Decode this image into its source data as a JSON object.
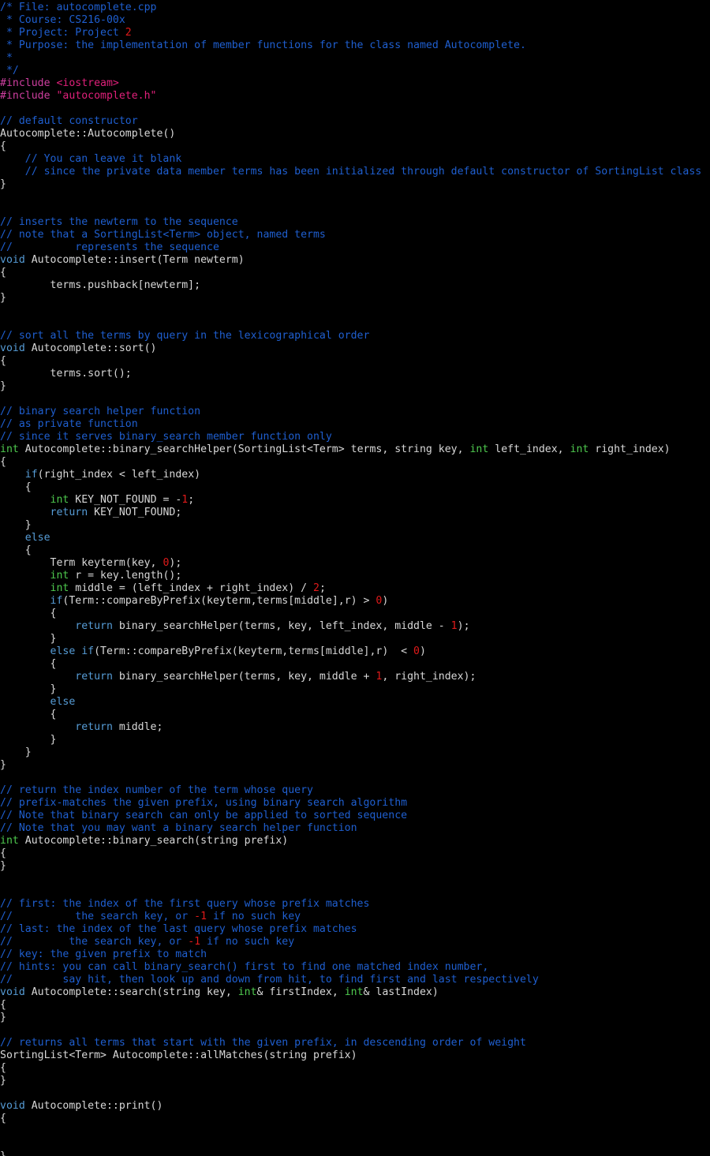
{
  "editor": {
    "file_name": "autocomplete.cpp",
    "colors": {
      "background": "#000000",
      "comment": "#1f5fd0",
      "keyword": "#569cd6",
      "type": "#4ec94e",
      "number": "#e01a1a",
      "string": "#e0207a",
      "directive": "#cf3fa0",
      "plain": "#d8d8d8"
    },
    "lines": [
      [
        [
          "comment",
          "/* File: autocomplete.cpp"
        ]
      ],
      [
        [
          "comment",
          " * Course: CS216-00x"
        ]
      ],
      [
        [
          "comment",
          " * Project: Project "
        ],
        [
          "number",
          "2"
        ]
      ],
      [
        [
          "comment",
          " * Purpose: the implementation of member functions for the class named Autocomplete."
        ]
      ],
      [
        [
          "comment",
          " *"
        ]
      ],
      [
        [
          "comment",
          " */"
        ]
      ],
      [
        [
          "directive",
          "#include "
        ],
        [
          "string",
          "<iostream>"
        ]
      ],
      [
        [
          "directive",
          "#include "
        ],
        [
          "string",
          "\"autocomplete.h\""
        ]
      ],
      [],
      [
        [
          "comment",
          "// default constructor"
        ]
      ],
      [
        [
          "plain",
          "Autocomplete::Autocomplete()"
        ]
      ],
      [
        [
          "plain",
          "{"
        ]
      ],
      [
        [
          "plain",
          "    "
        ],
        [
          "comment",
          "// You can leave it blank"
        ]
      ],
      [
        [
          "plain",
          "    "
        ],
        [
          "comment",
          "// since the private data member terms has been initialized through default constructor of SortingList class"
        ]
      ],
      [
        [
          "plain",
          "}"
        ]
      ],
      [],
      [],
      [
        [
          "comment",
          "// inserts the newterm to the sequence"
        ]
      ],
      [
        [
          "comment",
          "// note that a SortingList<Term> object, named terms"
        ]
      ],
      [
        [
          "comment",
          "//          represents the sequence"
        ]
      ],
      [
        [
          "keyword",
          "void"
        ],
        [
          "plain",
          " Autocomplete::insert(Term newterm)"
        ]
      ],
      [
        [
          "plain",
          "{"
        ]
      ],
      [
        [
          "plain",
          "        terms.pushback[newterm];"
        ]
      ],
      [
        [
          "plain",
          "}"
        ]
      ],
      [],
      [],
      [
        [
          "comment",
          "// sort all the terms by query in the lexicographical order"
        ]
      ],
      [
        [
          "keyword",
          "void"
        ],
        [
          "plain",
          " Autocomplete::sort()"
        ]
      ],
      [
        [
          "plain",
          "{"
        ]
      ],
      [
        [
          "plain",
          "        terms.sort();"
        ]
      ],
      [
        [
          "plain",
          "}"
        ]
      ],
      [],
      [
        [
          "comment",
          "// binary search helper function"
        ]
      ],
      [
        [
          "comment",
          "// as private function"
        ]
      ],
      [
        [
          "comment",
          "// since it serves binary_search member function only"
        ]
      ],
      [
        [
          "type",
          "int"
        ],
        [
          "plain",
          " Autocomplete::binary_searchHelper(SortingList<Term> terms, string key, "
        ],
        [
          "type",
          "int"
        ],
        [
          "plain",
          " left_index, "
        ],
        [
          "type",
          "int"
        ],
        [
          "plain",
          " right_index)"
        ]
      ],
      [
        [
          "plain",
          "{"
        ]
      ],
      [
        [
          "plain",
          "    "
        ],
        [
          "keyword",
          "if"
        ],
        [
          "plain",
          "(right_index < left_index)"
        ]
      ],
      [
        [
          "plain",
          "    {"
        ]
      ],
      [
        [
          "plain",
          "        "
        ],
        [
          "type",
          "int"
        ],
        [
          "plain",
          " KEY_NOT_FOUND = -"
        ],
        [
          "number",
          "1"
        ],
        [
          "plain",
          ";"
        ]
      ],
      [
        [
          "plain",
          "        "
        ],
        [
          "keyword",
          "return"
        ],
        [
          "plain",
          " KEY_NOT_FOUND;"
        ]
      ],
      [
        [
          "plain",
          "    }"
        ]
      ],
      [
        [
          "plain",
          "    "
        ],
        [
          "keyword",
          "else"
        ]
      ],
      [
        [
          "plain",
          "    {"
        ]
      ],
      [
        [
          "plain",
          "        Term keyterm(key, "
        ],
        [
          "number",
          "0"
        ],
        [
          "plain",
          ");"
        ]
      ],
      [
        [
          "plain",
          "        "
        ],
        [
          "type",
          "int"
        ],
        [
          "plain",
          " r = key.length();"
        ]
      ],
      [
        [
          "plain",
          "        "
        ],
        [
          "type",
          "int"
        ],
        [
          "plain",
          " middle = (left_index + right_index) / "
        ],
        [
          "number",
          "2"
        ],
        [
          "plain",
          ";"
        ]
      ],
      [
        [
          "plain",
          "        "
        ],
        [
          "keyword",
          "if"
        ],
        [
          "plain",
          "(Term::compareByPrefix(keyterm,terms[middle],r) > "
        ],
        [
          "number",
          "0"
        ],
        [
          "plain",
          ")"
        ]
      ],
      [
        [
          "plain",
          "        {"
        ]
      ],
      [
        [
          "plain",
          "            "
        ],
        [
          "keyword",
          "return"
        ],
        [
          "plain",
          " binary_searchHelper(terms, key, left_index, middle - "
        ],
        [
          "number",
          "1"
        ],
        [
          "plain",
          ");"
        ]
      ],
      [
        [
          "plain",
          "        }"
        ]
      ],
      [
        [
          "plain",
          "        "
        ],
        [
          "keyword",
          "else if"
        ],
        [
          "plain",
          "(Term::compareByPrefix(keyterm,terms[middle],r)  < "
        ],
        [
          "number",
          "0"
        ],
        [
          "plain",
          ")"
        ]
      ],
      [
        [
          "plain",
          "        {"
        ]
      ],
      [
        [
          "plain",
          "            "
        ],
        [
          "keyword",
          "return"
        ],
        [
          "plain",
          " binary_searchHelper(terms, key, middle + "
        ],
        [
          "number",
          "1"
        ],
        [
          "plain",
          ", right_index);"
        ]
      ],
      [
        [
          "plain",
          "        }"
        ]
      ],
      [
        [
          "plain",
          "        "
        ],
        [
          "keyword",
          "else"
        ]
      ],
      [
        [
          "plain",
          "        {"
        ]
      ],
      [
        [
          "plain",
          "            "
        ],
        [
          "keyword",
          "return"
        ],
        [
          "plain",
          " middle;"
        ]
      ],
      [
        [
          "plain",
          "        }"
        ]
      ],
      [
        [
          "plain",
          "    }"
        ]
      ],
      [
        [
          "plain",
          "}"
        ]
      ],
      [],
      [
        [
          "comment",
          "// return the index number of the term whose query"
        ]
      ],
      [
        [
          "comment",
          "// prefix-matches the given prefix, using binary search algorithm"
        ]
      ],
      [
        [
          "comment",
          "// Note that binary search can only be applied to sorted sequence"
        ]
      ],
      [
        [
          "comment",
          "// Note that you may want a binary search helper function"
        ]
      ],
      [
        [
          "type",
          "int"
        ],
        [
          "plain",
          " Autocomplete::binary_search(string prefix)"
        ]
      ],
      [
        [
          "plain",
          "{"
        ]
      ],
      [
        [
          "plain",
          "}"
        ]
      ],
      [],
      [],
      [
        [
          "comment",
          "// first: the index of the first query whose prefix matches"
        ]
      ],
      [
        [
          "comment",
          "//          the search key, or "
        ],
        [
          "number",
          "-1"
        ],
        [
          "comment",
          " if no such key"
        ]
      ],
      [
        [
          "comment",
          "// last: the index of the last query whose prefix matches"
        ]
      ],
      [
        [
          "comment",
          "//         the search key, or "
        ],
        [
          "number",
          "-1"
        ],
        [
          "comment",
          " if no such key"
        ]
      ],
      [
        [
          "comment",
          "// key: the given prefix to match"
        ]
      ],
      [
        [
          "comment",
          "// hints: you can call binary_search() first to find one matched index number,"
        ]
      ],
      [
        [
          "comment",
          "//        say hit, then look up and down from hit, to find first and last respectively"
        ]
      ],
      [
        [
          "keyword",
          "void"
        ],
        [
          "plain",
          " Autocomplete::search(string key, "
        ],
        [
          "type",
          "int"
        ],
        [
          "plain",
          "& firstIndex, "
        ],
        [
          "type",
          "int"
        ],
        [
          "plain",
          "& lastIndex)"
        ]
      ],
      [
        [
          "plain",
          "{"
        ]
      ],
      [
        [
          "plain",
          "}"
        ]
      ],
      [],
      [
        [
          "comment",
          "// returns all terms that start with the given prefix, in descending order of weight"
        ]
      ],
      [
        [
          "plain",
          "SortingList<Term> Autocomplete::allMatches(string prefix)"
        ]
      ],
      [
        [
          "plain",
          "{"
        ]
      ],
      [
        [
          "plain",
          "}"
        ]
      ],
      [],
      [
        [
          "keyword",
          "void"
        ],
        [
          "plain",
          " Autocomplete::print()"
        ]
      ],
      [
        [
          "plain",
          "{"
        ]
      ],
      [],
      [],
      [
        [
          "plain",
          "}"
        ]
      ]
    ]
  }
}
